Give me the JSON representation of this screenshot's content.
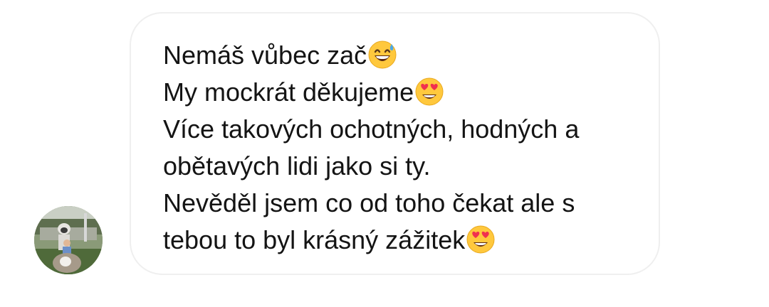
{
  "chat": {
    "sender": {
      "avatar_icon": "user-avatar-photo"
    },
    "message": {
      "lines": [
        {
          "text": "Nemáš vůbec zač",
          "emoji": "grinning-face-with-sweat-icon"
        },
        {
          "text": "My mockrát děkujeme",
          "emoji": "smiling-face-with-heart-eyes-icon"
        },
        {
          "text": "Více takových ochotných, hodných a",
          "emoji": ""
        },
        {
          "text": "obětavých lidi jako si ty.",
          "emoji": ""
        },
        {
          "text": "Nevěděl jsem co od toho čekat ale s",
          "emoji": ""
        },
        {
          "text": "tebou to byl krásný zážitek",
          "emoji": "smiling-face-with-heart-eyes-icon"
        }
      ]
    }
  },
  "colors": {
    "text": "#141414",
    "bubble_border": "#efefef",
    "background": "#ffffff",
    "emoji_face": "#ffc83d",
    "emoji_heart": "#f0304f"
  }
}
